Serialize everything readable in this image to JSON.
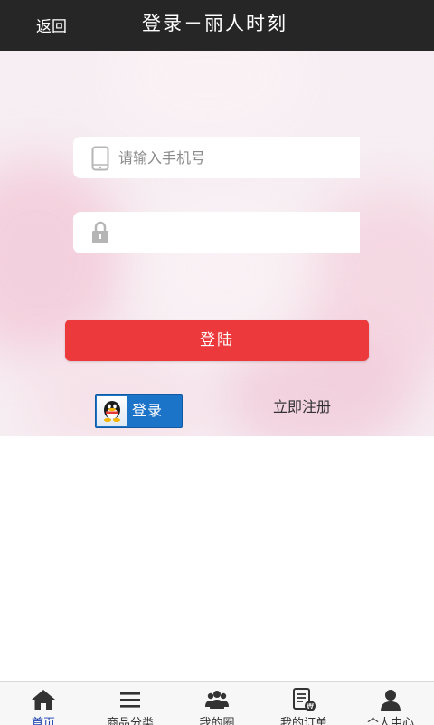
{
  "header": {
    "back_label": "返回",
    "title": "登录－丽人时刻"
  },
  "login": {
    "phone_placeholder": "请输入手机号",
    "phone_value": "",
    "password_placeholder": "",
    "password_value": "",
    "submit_label": "登陆",
    "qq_login_label": "登录",
    "register_label": "立即注册"
  },
  "tabbar": {
    "active_tab": "home",
    "tabs": [
      {
        "id": "home",
        "label": "首页",
        "icon": "home-icon"
      },
      {
        "id": "categories",
        "label": "商品分类",
        "icon": "menu-icon"
      },
      {
        "id": "circle",
        "label": "我的圈",
        "icon": "group-icon"
      },
      {
        "id": "orders",
        "label": "我的订单",
        "icon": "order-icon"
      },
      {
        "id": "me",
        "label": "个人中心",
        "icon": "user-icon"
      }
    ]
  },
  "colors": {
    "header_bg": "#262626",
    "accent_red": "#ec3a3c",
    "qq_blue": "#1c74c9",
    "active_tab": "#1a3fb0"
  }
}
